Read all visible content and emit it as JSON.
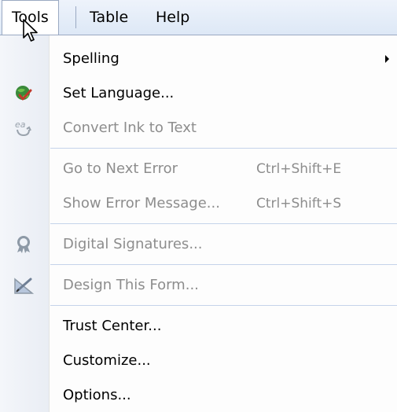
{
  "menubar": {
    "items": [
      {
        "label": "Tools",
        "active": true
      },
      {
        "label": "Table",
        "active": false
      },
      {
        "label": "Help",
        "active": false
      }
    ]
  },
  "menu": {
    "items": [
      {
        "label": "Spelling",
        "shortcut": "",
        "disabled": false,
        "submenu": true,
        "icon": "none"
      },
      {
        "label": "Set Language...",
        "shortcut": "",
        "disabled": false,
        "submenu": false,
        "icon": "globe-check-icon"
      },
      {
        "label": "Convert Ink to Text",
        "shortcut": "",
        "disabled": true,
        "submenu": false,
        "icon": "ink-convert-icon"
      },
      {
        "label": "Go to Next Error",
        "shortcut": "Ctrl+Shift+E",
        "disabled": true,
        "submenu": false,
        "icon": "none"
      },
      {
        "label": "Show Error Message...",
        "shortcut": "Ctrl+Shift+S",
        "disabled": true,
        "submenu": false,
        "icon": "none"
      },
      {
        "label": "Digital Signatures...",
        "shortcut": "",
        "disabled": true,
        "submenu": false,
        "icon": "digital-signature-icon"
      },
      {
        "label": "Design This Form...",
        "shortcut": "",
        "disabled": true,
        "submenu": false,
        "icon": "design-form-icon"
      },
      {
        "label": "Trust Center...",
        "shortcut": "",
        "disabled": false,
        "submenu": false,
        "icon": "none"
      },
      {
        "label": "Customize...",
        "shortcut": "",
        "disabled": false,
        "submenu": false,
        "icon": "none"
      },
      {
        "label": "Options...",
        "shortcut": "",
        "disabled": false,
        "submenu": false,
        "icon": "none"
      }
    ]
  },
  "colors": {
    "menubar_bg": "#dde8f6",
    "separator": "#c5d3ea",
    "disabled_text": "#8d8d8d",
    "gutter_bg": "#eceff5"
  }
}
